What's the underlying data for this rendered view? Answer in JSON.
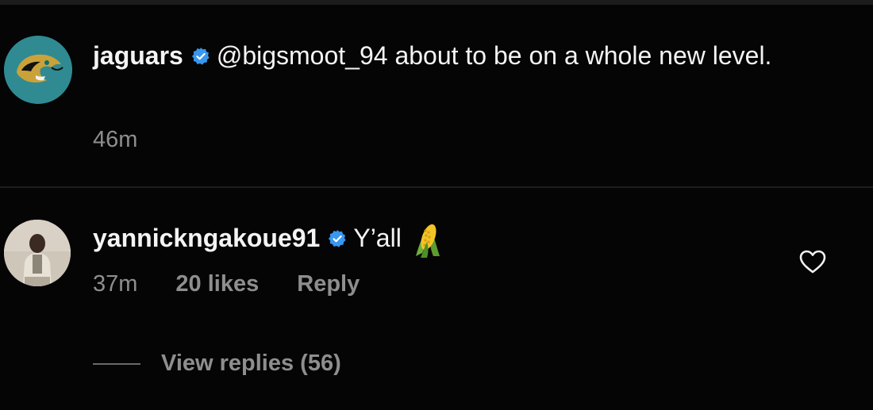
{
  "comment1": {
    "username": "jaguars",
    "verified": true,
    "text": "@bigsmoot_94 about to be on a whole new level.",
    "time": "46m",
    "avatar_icon": "jaguars-logo-icon"
  },
  "comment2": {
    "username": "yannickngakoue91",
    "verified": true,
    "text": "Y’all",
    "emoji_icon": "corn-emoji-icon",
    "time": "37m",
    "likes": "20 likes",
    "reply_label": "Reply",
    "like_icon": "heart-icon"
  },
  "view_replies": {
    "label": "View replies (56)"
  },
  "colors": {
    "background": "#050505",
    "text": "#f4f4f4",
    "meta": "#8e8e8e",
    "verified": "#3897f0",
    "jaguars_teal": "#2f8a92"
  }
}
